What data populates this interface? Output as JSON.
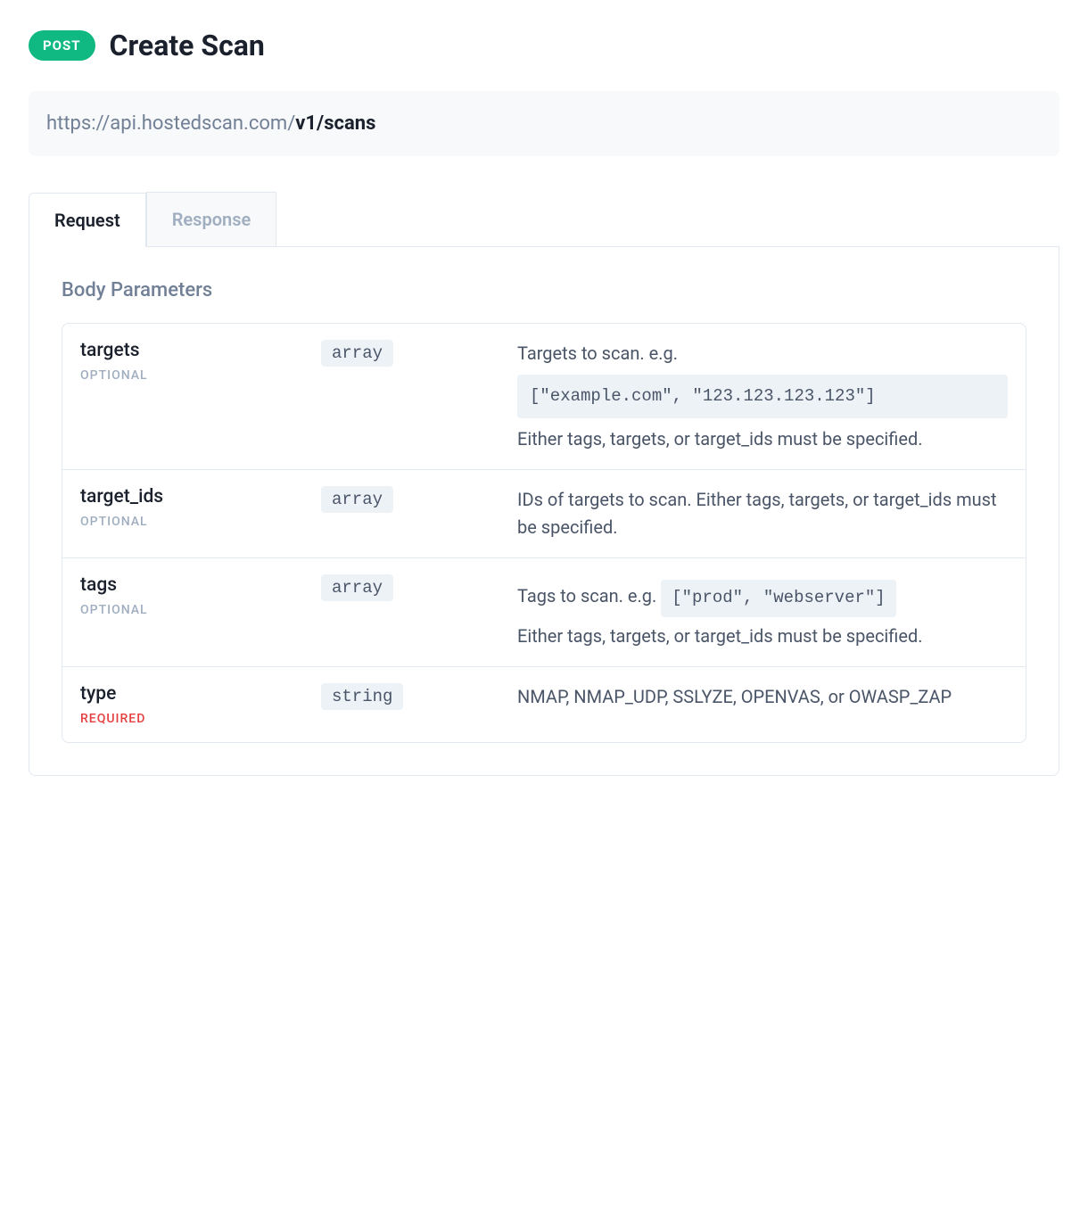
{
  "header": {
    "method": "POST",
    "title": "Create Scan"
  },
  "url": {
    "base": "https://api.hostedscan.com/",
    "path": "v1/scans"
  },
  "tabs": {
    "request": "Request",
    "response": "Response"
  },
  "section": {
    "body_parameters": "Body Parameters"
  },
  "params": {
    "targets": {
      "name": "targets",
      "required_label": "OPTIONAL",
      "type": "array",
      "desc_prefix": "Targets to scan. e.g.",
      "desc_code": "[\"example.com\", \"123.123.123.123\"]",
      "desc_suffix": "Either tags, targets, or target_ids must be specified."
    },
    "target_ids": {
      "name": "target_ids",
      "required_label": "OPTIONAL",
      "type": "array",
      "desc": "IDs of targets to scan. Either tags, targets, or target_ids must be specified."
    },
    "tags": {
      "name": "tags",
      "required_label": "OPTIONAL",
      "type": "array",
      "desc_prefix": "Tags to scan. e.g.",
      "desc_code": "[\"prod\", \"webserver\"]",
      "desc_suffix": "Either tags, targets, or target_ids must be specified."
    },
    "type": {
      "name": "type",
      "required_label": "REQUIRED",
      "type": "string",
      "desc": "NMAP, NMAP_UDP, SSLYZE, OPENVAS, or OWASP_ZAP"
    }
  }
}
